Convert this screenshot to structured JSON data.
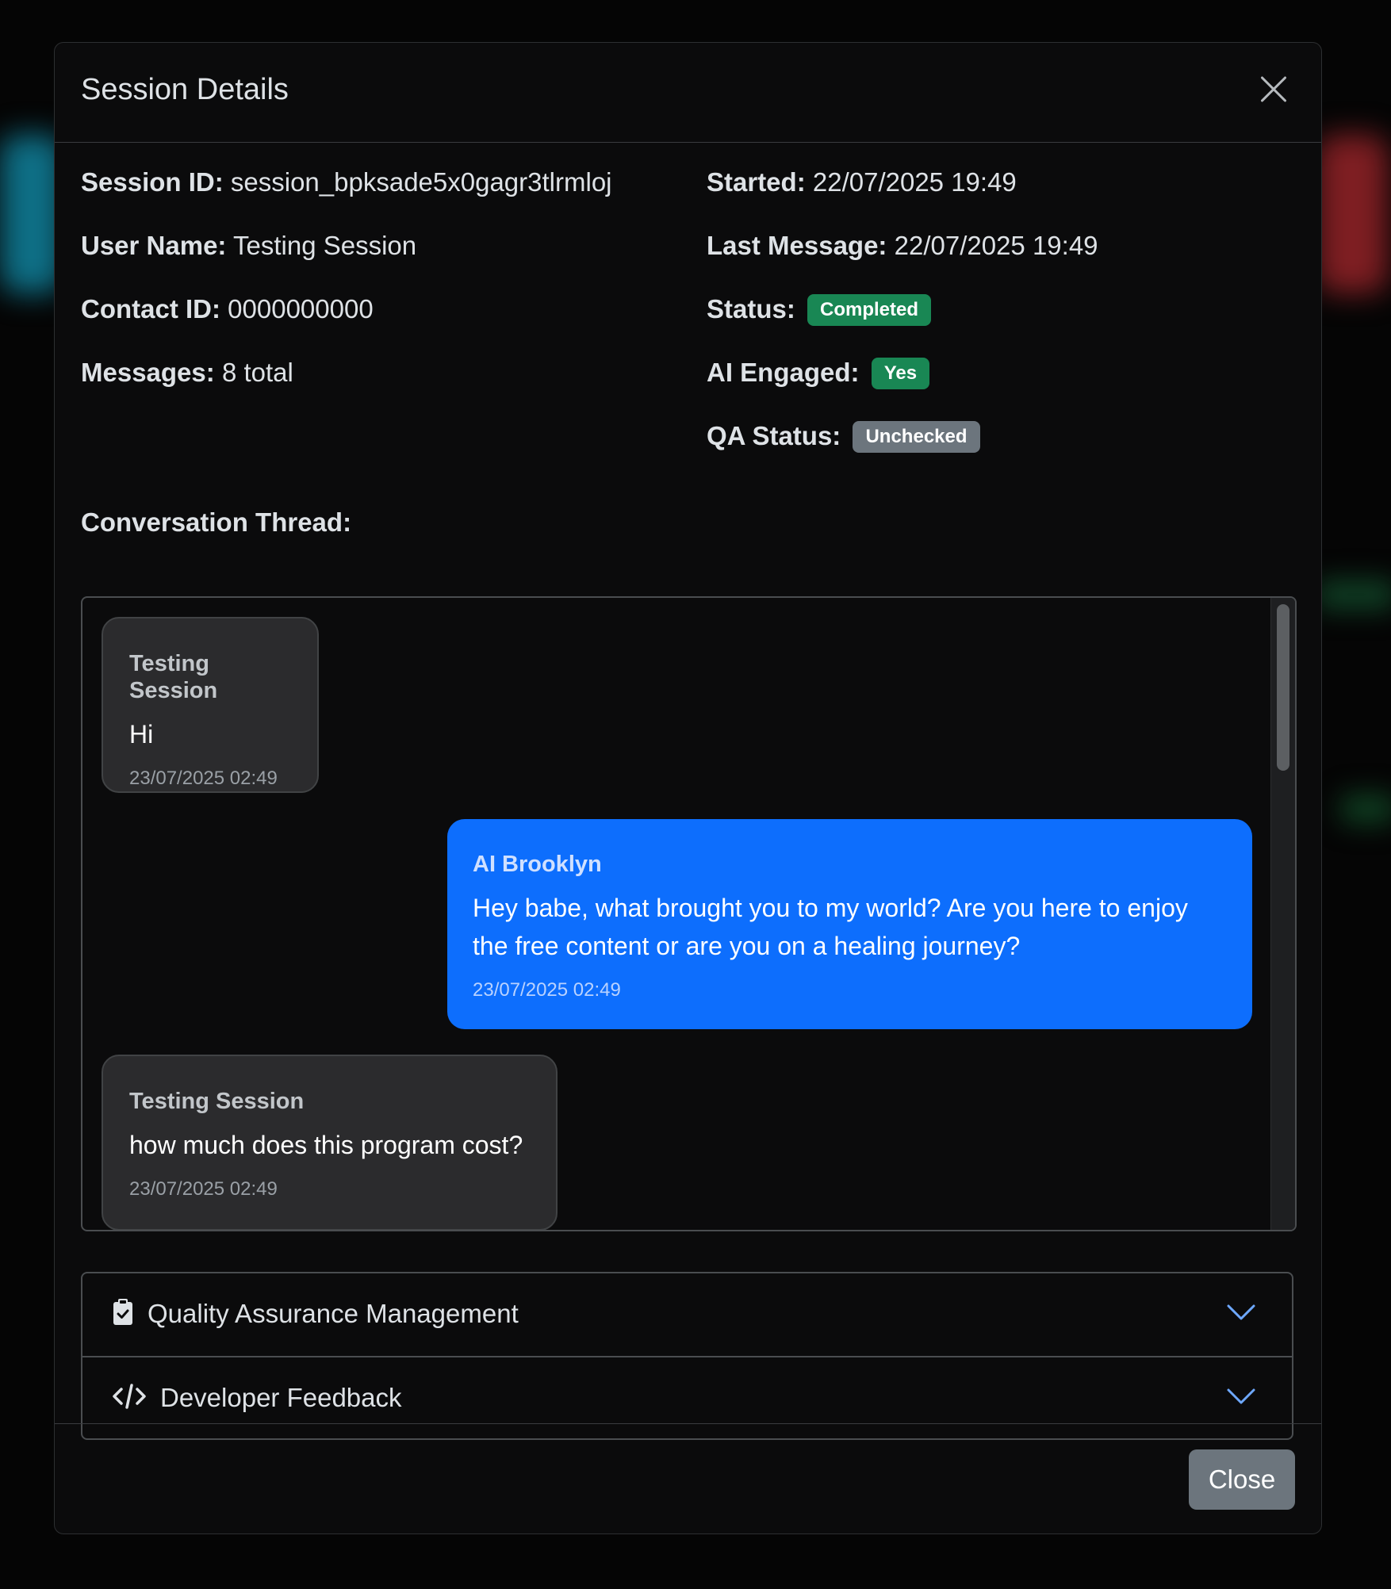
{
  "modal": {
    "title": "Session Details",
    "close_button_label": "Close"
  },
  "info_left": [
    {
      "label": "Session ID:",
      "value": "session_bpksade5x0gagr3tlrmloj"
    },
    {
      "label": "User Name:",
      "value": "Testing Session"
    },
    {
      "label": "Contact ID:",
      "value": "0000000000"
    },
    {
      "label": "Messages:",
      "value": "8 total"
    }
  ],
  "info_right": {
    "started": {
      "label": "Started:",
      "value": "22/07/2025 19:49"
    },
    "last_message": {
      "label": "Last Message:",
      "value": "22/07/2025 19:49"
    },
    "status": {
      "label": "Status:",
      "badge": "Completed",
      "color": "#198754"
    },
    "ai_engaged": {
      "label": "AI Engaged:",
      "badge": "Yes",
      "color": "#198754"
    },
    "qa_status": {
      "label": "QA Status:",
      "badge": "Unchecked",
      "color": "#6c757d"
    }
  },
  "thread": {
    "label": "Conversation Thread:",
    "messages": [
      {
        "sender": "Testing Session",
        "text": "Hi",
        "time": "23/07/2025 02:49",
        "role": "user"
      },
      {
        "sender": "AI Brooklyn",
        "text": "Hey babe, what brought you to my world? Are you here to enjoy the free content or are you on a healing journey?",
        "time": "23/07/2025 02:49",
        "role": "ai"
      },
      {
        "sender": "Testing Session",
        "text": "how much does this program cost?",
        "time": "23/07/2025 02:49",
        "role": "user"
      }
    ]
  },
  "accordion": [
    {
      "label": "Quality Assurance Management",
      "icon": "clipboard-check-icon"
    },
    {
      "label": "Developer Feedback",
      "icon": "code-icon"
    }
  ],
  "colors": {
    "ai_bubble": "#0d6efd",
    "user_bubble": "#2b2b2d",
    "accent_chevron": "#6ea8fe"
  }
}
